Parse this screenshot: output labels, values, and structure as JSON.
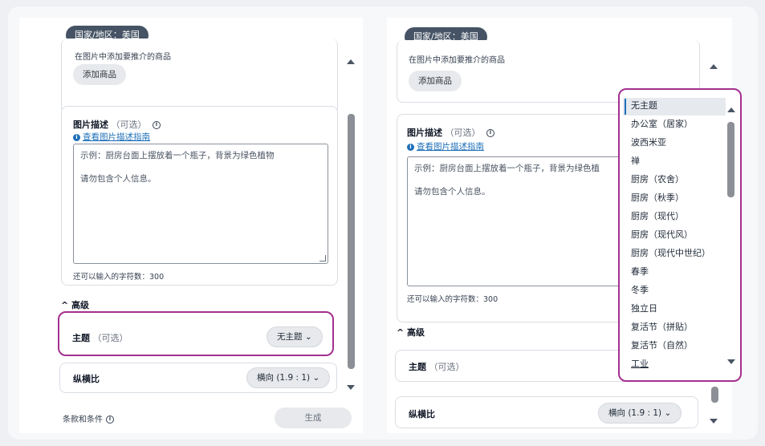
{
  "left": {
    "region": "国家/地区：美国",
    "add_hint": "在图片中添加要推介的商品",
    "add_button": "添加商品",
    "desc_label": "图片描述",
    "desc_optional": "（可选）",
    "guide_link": "查看图片描述指南",
    "desc_placeholder_1": "示例：厨房台面上摆放着一个瓶子，背景为绿色植物",
    "desc_placeholder_2": "请勿包含个人信息。",
    "char_count": "还可以输入的字符数：300",
    "advanced": "高级",
    "theme_label": "主题",
    "theme_optional": "（可选）",
    "theme_value": "无主题",
    "ratio_label": "纵横比",
    "ratio_value": "横向 (1.9 : 1)",
    "terms": "条款和条件",
    "generate": "生成"
  },
  "right": {
    "region": "国家/地区：美国",
    "add_hint": "在图片中添加要推介的商品",
    "add_button": "添加商品",
    "desc_label": "图片描述",
    "desc_optional": "（可选）",
    "guide_link": "查看图片描述指南",
    "desc_placeholder_1": "示例：厨房台面上摆放着一个瓶子，背景为绿色植",
    "desc_placeholder_2": "请勿包含个人信息。",
    "char_count": "还可以输入的字符数：300",
    "advanced": "高级",
    "theme_label": "主题",
    "theme_optional": "（可选）",
    "ratio_label": "纵横比",
    "ratio_value": "横向 (1.9 : 1)"
  },
  "dropdown": {
    "selected": "无主题",
    "options": [
      "无主题",
      "办公室（居家）",
      "波西米亚",
      "禅",
      "厨房（农舍）",
      "厨房（秋季）",
      "厨房（现代）",
      "厨房（现代风）",
      "厨房（现代中世纪）",
      "春季",
      "冬季",
      "独立日",
      "复活节（拼贴）",
      "复活节（自然）",
      "工业"
    ]
  },
  "colors": {
    "highlight": "#a4308f",
    "pill": "#455364",
    "link": "#1d6fb8"
  }
}
